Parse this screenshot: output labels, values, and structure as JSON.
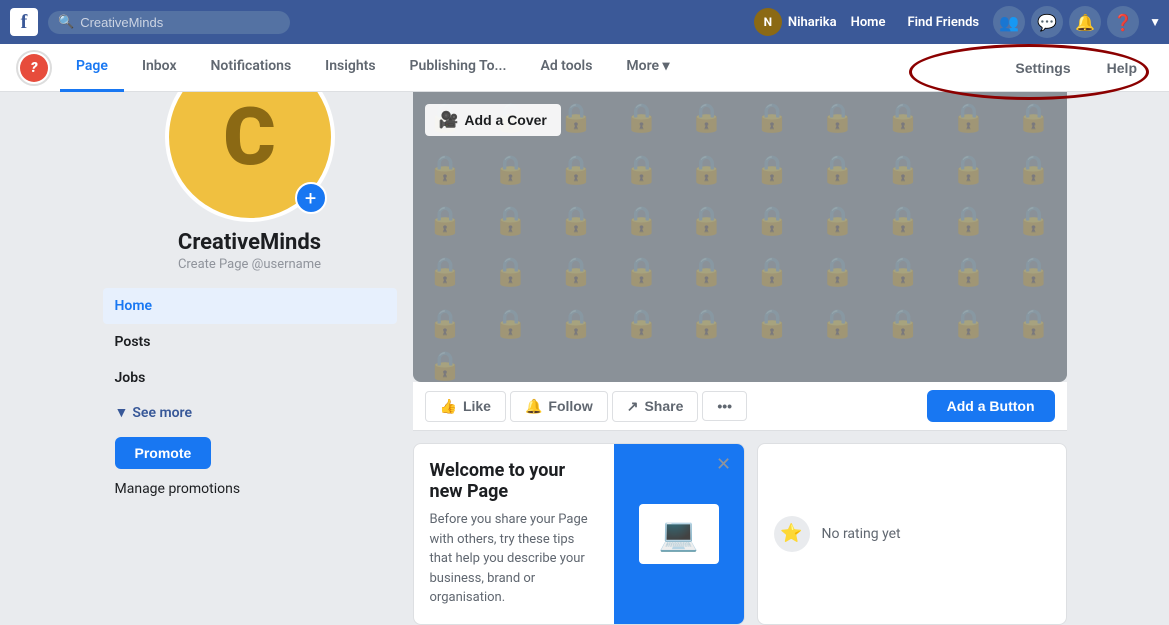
{
  "topNav": {
    "logo": "f",
    "searchPlaceholder": "CreativeMinds",
    "userName": "Niharika",
    "links": [
      "Home",
      "Find Friends"
    ],
    "icons": [
      "people-icon",
      "messenger-icon",
      "notifications-icon",
      "help-icon"
    ]
  },
  "pageNav": {
    "tabs": [
      {
        "label": "Page",
        "active": true
      },
      {
        "label": "Inbox"
      },
      {
        "label": "Notifications"
      },
      {
        "label": "Insights"
      },
      {
        "label": "Publishing To..."
      },
      {
        "label": "Ad tools"
      },
      {
        "label": "More ▾"
      }
    ],
    "rightButtons": [
      "Settings",
      "Help"
    ]
  },
  "sidebar": {
    "pageInitial": "C",
    "pageName": "CreativeMinds",
    "pageUsername": "Create Page @username",
    "navItems": [
      {
        "label": "Home",
        "active": true
      },
      {
        "label": "Posts"
      },
      {
        "label": "Jobs"
      }
    ],
    "seeMore": "See more",
    "promoteBtn": "Promote",
    "managePromo": "Manage promotions"
  },
  "coverPhoto": {
    "addCoverLabel": "Add a Cover",
    "videoIcon": "▶"
  },
  "actionBar": {
    "likeLabel": "Like",
    "followLabel": "Follow",
    "shareLabel": "Share",
    "moreIcon": "•••",
    "addButtonLabel": "Add a Button"
  },
  "welcomeCard": {
    "title": "Welcome to your new Page",
    "text": "Before you share your Page with others, try these tips that help you describe your business, brand or organisation."
  },
  "ratingCard": {
    "text": "No rating yet"
  }
}
